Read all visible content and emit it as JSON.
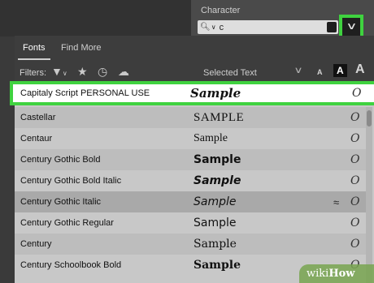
{
  "panel": {
    "title": "Character",
    "search_value": "c",
    "dropdown_button": "chevron-down-icon"
  },
  "popup": {
    "tabs": [
      {
        "label": "Fonts",
        "active": true
      },
      {
        "label": "Find More",
        "active": false
      }
    ],
    "filters_label": "Filters:",
    "filter_icons": [
      "filter-icon",
      "star-icon",
      "clock-icon",
      "cloud-check-icon"
    ],
    "selected_text_label": "Selected Text",
    "size_buttons": [
      "A",
      "A",
      "A"
    ]
  },
  "fonts": [
    {
      "name": "Capitaly Script PERSONAL USE",
      "sample": "Sample",
      "style": "script",
      "selected": true,
      "approx": ""
    },
    {
      "name": "Castellar",
      "sample": "SAMPLE",
      "style": "castellar",
      "selected": false,
      "approx": ""
    },
    {
      "name": "Centaur",
      "sample": "Sample",
      "style": "centaur",
      "selected": false,
      "approx": ""
    },
    {
      "name": "Century Gothic Bold",
      "sample": "Sample",
      "style": "gothic-bold",
      "selected": false,
      "approx": ""
    },
    {
      "name": "Century Gothic Bold Italic",
      "sample": "Sample",
      "style": "gothic-bold-italic",
      "selected": false,
      "approx": ""
    },
    {
      "name": "Century Gothic Italic",
      "sample": "Sample",
      "style": "gothic-italic",
      "selected": false,
      "approx": "≈",
      "hovered": true
    },
    {
      "name": "Century Gothic Regular",
      "sample": "Sample",
      "style": "gothic",
      "selected": false,
      "approx": ""
    },
    {
      "name": "Century",
      "sample": "Sample",
      "style": "century",
      "selected": false,
      "approx": ""
    },
    {
      "name": "Century Schoolbook Bold",
      "sample": "Sample",
      "style": "schoolbook-bold",
      "selected": false,
      "approx": ""
    }
  ],
  "font_type_mark": "O",
  "watermark": {
    "prefix": "wiki",
    "suffix": "How"
  },
  "colors": {
    "highlight": "#3fd23f",
    "popup_bg": "#c8c8c8",
    "header_bg": "#3d3d3d"
  }
}
